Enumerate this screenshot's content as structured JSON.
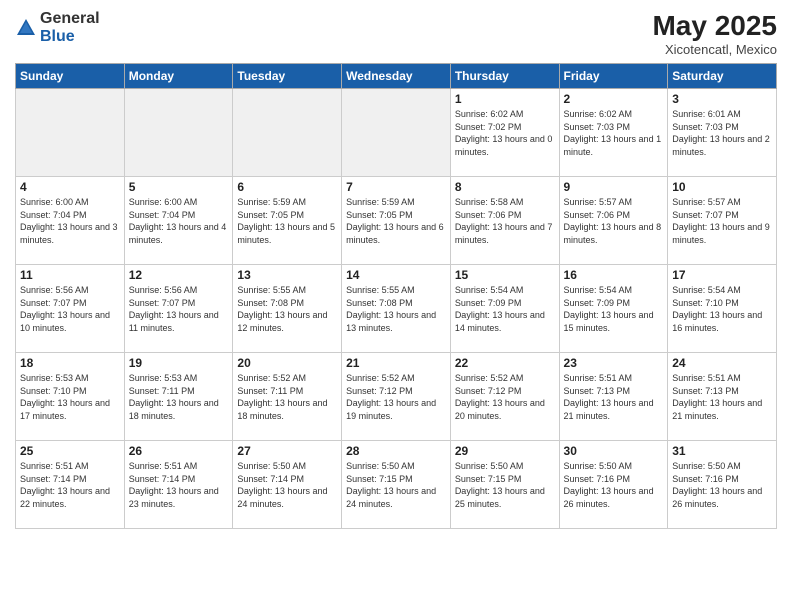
{
  "logo": {
    "general": "General",
    "blue": "Blue"
  },
  "header": {
    "month": "May 2025",
    "location": "Xicotencatl, Mexico"
  },
  "weekdays": [
    "Sunday",
    "Monday",
    "Tuesday",
    "Wednesday",
    "Thursday",
    "Friday",
    "Saturday"
  ],
  "weeks": [
    [
      {
        "day": "",
        "info": ""
      },
      {
        "day": "",
        "info": ""
      },
      {
        "day": "",
        "info": ""
      },
      {
        "day": "",
        "info": ""
      },
      {
        "day": "1",
        "info": "Sunrise: 6:02 AM\nSunset: 7:02 PM\nDaylight: 13 hours and 0 minutes."
      },
      {
        "day": "2",
        "info": "Sunrise: 6:02 AM\nSunset: 7:03 PM\nDaylight: 13 hours and 1 minute."
      },
      {
        "day": "3",
        "info": "Sunrise: 6:01 AM\nSunset: 7:03 PM\nDaylight: 13 hours and 2 minutes."
      }
    ],
    [
      {
        "day": "4",
        "info": "Sunrise: 6:00 AM\nSunset: 7:04 PM\nDaylight: 13 hours and 3 minutes."
      },
      {
        "day": "5",
        "info": "Sunrise: 6:00 AM\nSunset: 7:04 PM\nDaylight: 13 hours and 4 minutes."
      },
      {
        "day": "6",
        "info": "Sunrise: 5:59 AM\nSunset: 7:05 PM\nDaylight: 13 hours and 5 minutes."
      },
      {
        "day": "7",
        "info": "Sunrise: 5:59 AM\nSunset: 7:05 PM\nDaylight: 13 hours and 6 minutes."
      },
      {
        "day": "8",
        "info": "Sunrise: 5:58 AM\nSunset: 7:06 PM\nDaylight: 13 hours and 7 minutes."
      },
      {
        "day": "9",
        "info": "Sunrise: 5:57 AM\nSunset: 7:06 PM\nDaylight: 13 hours and 8 minutes."
      },
      {
        "day": "10",
        "info": "Sunrise: 5:57 AM\nSunset: 7:07 PM\nDaylight: 13 hours and 9 minutes."
      }
    ],
    [
      {
        "day": "11",
        "info": "Sunrise: 5:56 AM\nSunset: 7:07 PM\nDaylight: 13 hours and 10 minutes."
      },
      {
        "day": "12",
        "info": "Sunrise: 5:56 AM\nSunset: 7:07 PM\nDaylight: 13 hours and 11 minutes."
      },
      {
        "day": "13",
        "info": "Sunrise: 5:55 AM\nSunset: 7:08 PM\nDaylight: 13 hours and 12 minutes."
      },
      {
        "day": "14",
        "info": "Sunrise: 5:55 AM\nSunset: 7:08 PM\nDaylight: 13 hours and 13 minutes."
      },
      {
        "day": "15",
        "info": "Sunrise: 5:54 AM\nSunset: 7:09 PM\nDaylight: 13 hours and 14 minutes."
      },
      {
        "day": "16",
        "info": "Sunrise: 5:54 AM\nSunset: 7:09 PM\nDaylight: 13 hours and 15 minutes."
      },
      {
        "day": "17",
        "info": "Sunrise: 5:54 AM\nSunset: 7:10 PM\nDaylight: 13 hours and 16 minutes."
      }
    ],
    [
      {
        "day": "18",
        "info": "Sunrise: 5:53 AM\nSunset: 7:10 PM\nDaylight: 13 hours and 17 minutes."
      },
      {
        "day": "19",
        "info": "Sunrise: 5:53 AM\nSunset: 7:11 PM\nDaylight: 13 hours and 18 minutes."
      },
      {
        "day": "20",
        "info": "Sunrise: 5:52 AM\nSunset: 7:11 PM\nDaylight: 13 hours and 18 minutes."
      },
      {
        "day": "21",
        "info": "Sunrise: 5:52 AM\nSunset: 7:12 PM\nDaylight: 13 hours and 19 minutes."
      },
      {
        "day": "22",
        "info": "Sunrise: 5:52 AM\nSunset: 7:12 PM\nDaylight: 13 hours and 20 minutes."
      },
      {
        "day": "23",
        "info": "Sunrise: 5:51 AM\nSunset: 7:13 PM\nDaylight: 13 hours and 21 minutes."
      },
      {
        "day": "24",
        "info": "Sunrise: 5:51 AM\nSunset: 7:13 PM\nDaylight: 13 hours and 21 minutes."
      }
    ],
    [
      {
        "day": "25",
        "info": "Sunrise: 5:51 AM\nSunset: 7:14 PM\nDaylight: 13 hours and 22 minutes."
      },
      {
        "day": "26",
        "info": "Sunrise: 5:51 AM\nSunset: 7:14 PM\nDaylight: 13 hours and 23 minutes."
      },
      {
        "day": "27",
        "info": "Sunrise: 5:50 AM\nSunset: 7:14 PM\nDaylight: 13 hours and 24 minutes."
      },
      {
        "day": "28",
        "info": "Sunrise: 5:50 AM\nSunset: 7:15 PM\nDaylight: 13 hours and 24 minutes."
      },
      {
        "day": "29",
        "info": "Sunrise: 5:50 AM\nSunset: 7:15 PM\nDaylight: 13 hours and 25 minutes."
      },
      {
        "day": "30",
        "info": "Sunrise: 5:50 AM\nSunset: 7:16 PM\nDaylight: 13 hours and 26 minutes."
      },
      {
        "day": "31",
        "info": "Sunrise: 5:50 AM\nSunset: 7:16 PM\nDaylight: 13 hours and 26 minutes."
      }
    ]
  ]
}
